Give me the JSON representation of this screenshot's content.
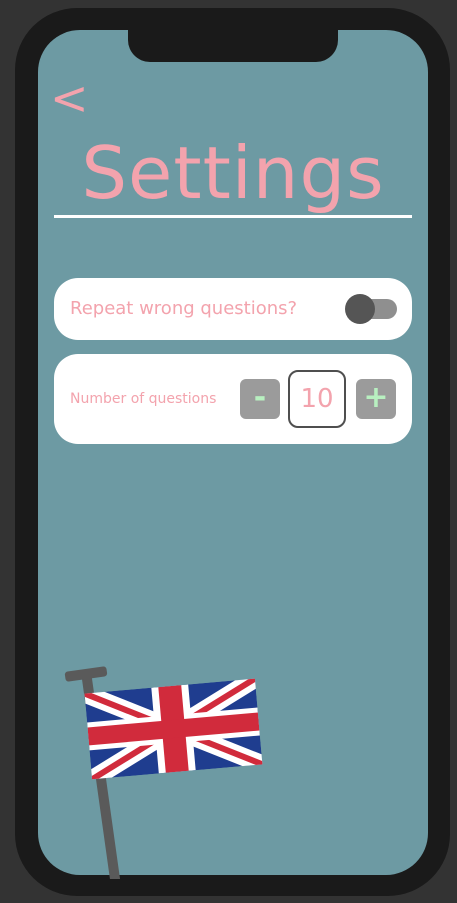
{
  "header": {
    "back_glyph": "<",
    "title": "Settings"
  },
  "settings": {
    "repeat_wrong": {
      "label": "Repeat wrong questions?",
      "enabled": false
    },
    "number_of_questions": {
      "label": "Number of questions",
      "minus_label": "-",
      "plus_label": "+",
      "value": "10"
    }
  },
  "colors": {
    "background": "#6d9aa3",
    "accent_pink": "#f3a3ad",
    "button_gray": "#9b9b9b",
    "button_text_green": "#b8f0c0"
  },
  "decoration": {
    "flag_icon": "uk-flag-icon"
  }
}
